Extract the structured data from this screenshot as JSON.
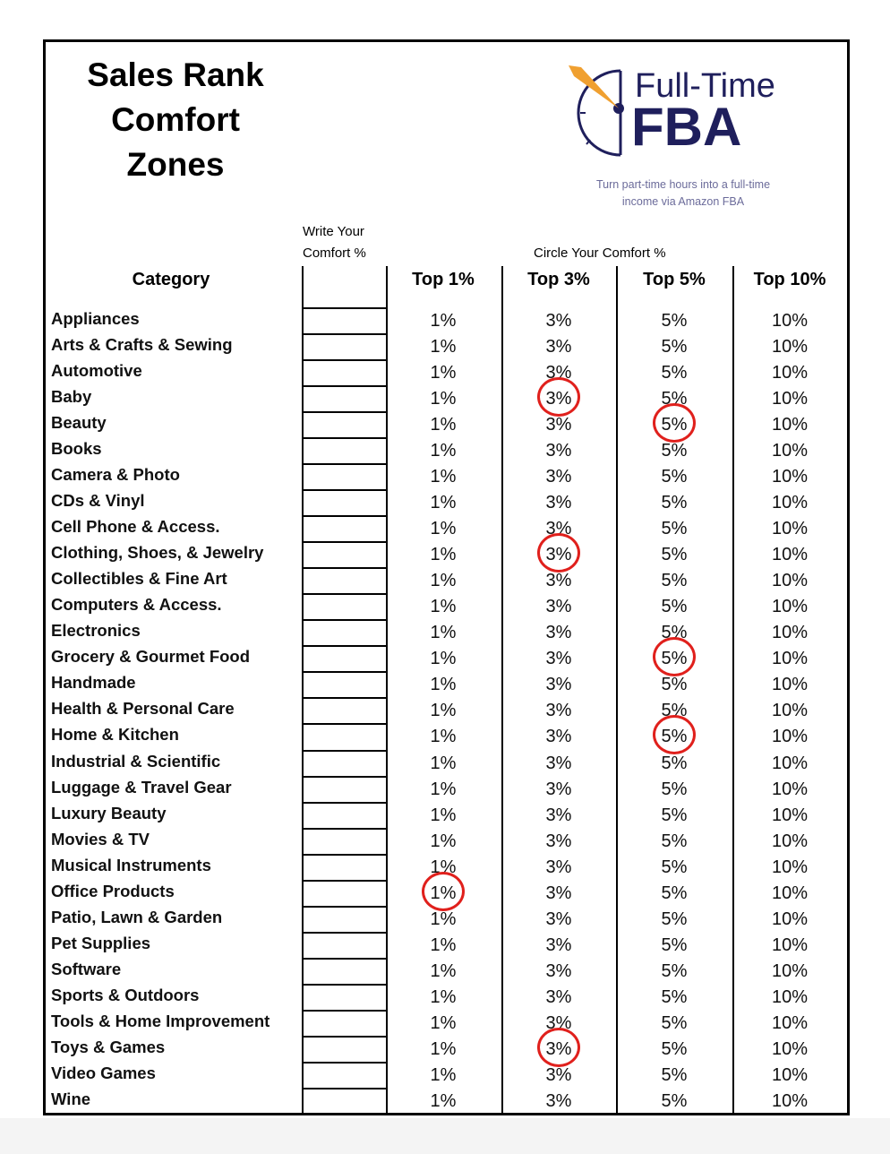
{
  "title_lines": [
    "Sales Rank",
    "Comfort",
    "Zones"
  ],
  "logo": {
    "line1": "Full-Time",
    "line2": "FBA",
    "tagline1": "Turn part-time hours into a full-time",
    "tagline2": "income via Amazon FBA",
    "brand_color": "#1f1f5c",
    "accent_color": "#f0a030"
  },
  "headers": {
    "write_line1": "Write Your",
    "write_line2": "Comfort %",
    "circle": "Circle Your  Comfort %",
    "category": "Category",
    "options": [
      "Top 1%",
      "Top 3%",
      "Top 5%",
      "Top 10%"
    ]
  },
  "option_values": [
    "1%",
    "3%",
    "5%",
    "10%"
  ],
  "circle_color": "#e0201c",
  "rows": [
    {
      "category": "Appliances",
      "circled": null
    },
    {
      "category": "Arts & Crafts & Sewing",
      "circled": null
    },
    {
      "category": "Automotive",
      "circled": null
    },
    {
      "category": "Baby",
      "circled": 1
    },
    {
      "category": "Beauty",
      "circled": 2
    },
    {
      "category": "Books",
      "circled": null
    },
    {
      "category": "Camera & Photo",
      "circled": null
    },
    {
      "category": "CDs & Vinyl",
      "circled": null
    },
    {
      "category": "Cell Phone & Access.",
      "circled": null
    },
    {
      "category": "Clothing, Shoes, & Jewelry",
      "circled": 1
    },
    {
      "category": "Collectibles & Fine Art",
      "circled": null
    },
    {
      "category": "Computers & Access.",
      "circled": null
    },
    {
      "category": "Electronics",
      "circled": null
    },
    {
      "category": "Grocery & Gourmet Food",
      "circled": 2
    },
    {
      "category": "Handmade",
      "circled": null
    },
    {
      "category": "Health & Personal Care",
      "circled": null
    },
    {
      "category": "Home & Kitchen",
      "circled": 2
    },
    {
      "category": "Industrial & Scientific",
      "circled": null
    },
    {
      "category": "Luggage & Travel Gear",
      "circled": null
    },
    {
      "category": "Luxury Beauty",
      "circled": null
    },
    {
      "category": "Movies & TV",
      "circled": null
    },
    {
      "category": "Musical Instruments",
      "circled": null
    },
    {
      "category": "Office Products",
      "circled": 0
    },
    {
      "category": "Patio, Lawn & Garden",
      "circled": null
    },
    {
      "category": "Pet Supplies",
      "circled": null
    },
    {
      "category": "Software",
      "circled": null
    },
    {
      "category": "Sports & Outdoors",
      "circled": null
    },
    {
      "category": "Tools & Home Improvement",
      "circled": null
    },
    {
      "category": "Toys & Games",
      "circled": 1
    },
    {
      "category": "Video Games",
      "circled": null
    },
    {
      "category": "Wine",
      "circled": null
    }
  ]
}
